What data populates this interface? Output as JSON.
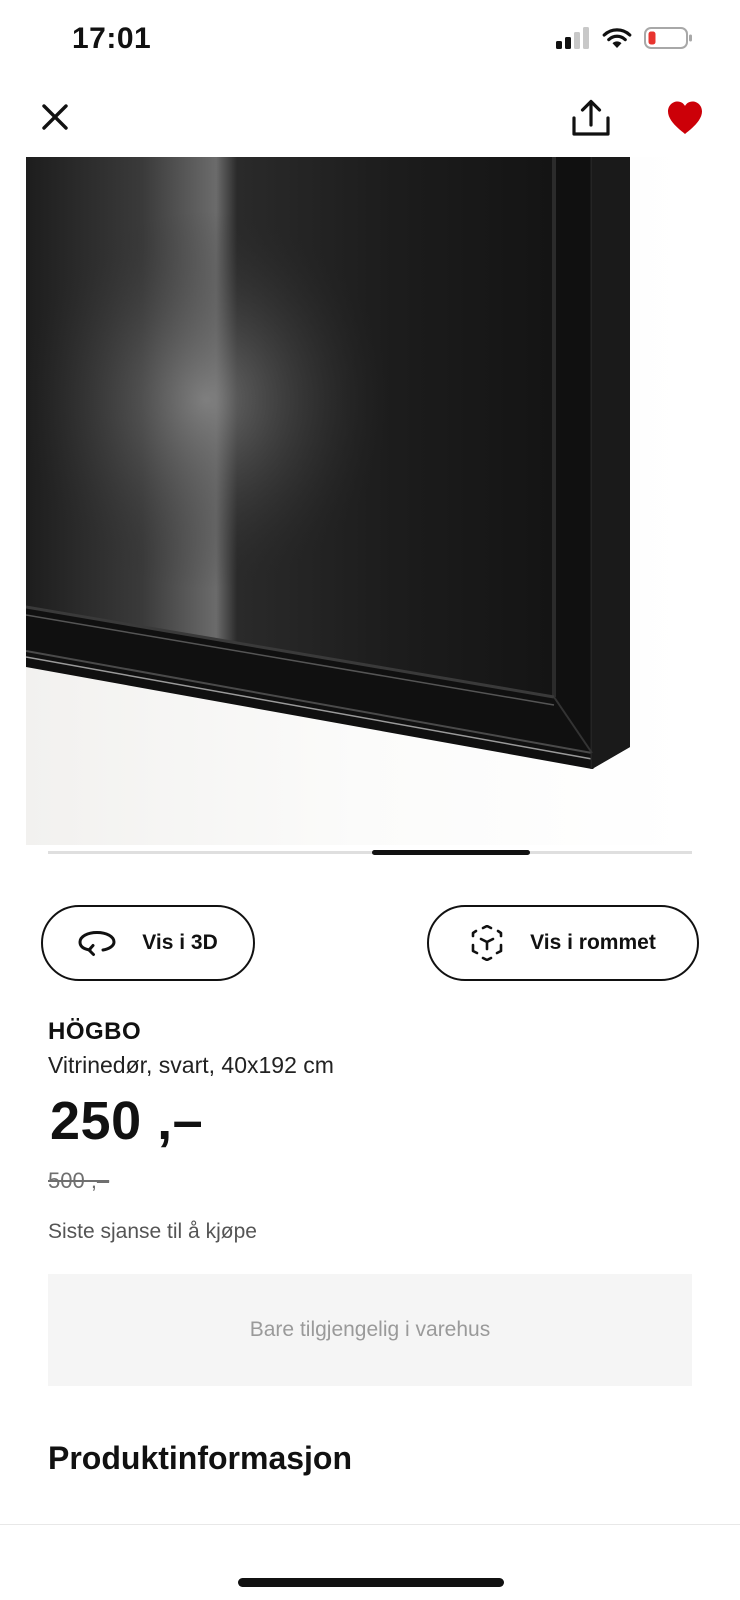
{
  "status_bar": {
    "time": "17:01",
    "icons": [
      "cellular-signal-icon",
      "wifi-icon",
      "battery-low-icon"
    ]
  },
  "toolbar": {
    "icons": [
      "close-icon",
      "share-icon",
      "heart-icon"
    ],
    "favorite_color": "#cc0008"
  },
  "gallery": {
    "image": "black-glass-door-frame-closeup"
  },
  "actions": {
    "view_3d_label": "Vis i 3D",
    "view_3d_icon": "rotate-3d-icon",
    "view_room_label": "Vis i rommet",
    "view_room_icon": "ar-cube-icon"
  },
  "product": {
    "brand": "HÖGBO",
    "description": "Vitrinedør, svart, 40x192 cm",
    "price": "250 ,–",
    "old_price": "500 ,–",
    "notice": "Siste sjanse til å kjøpe",
    "availability": "Bare tilgjengelig i varehus"
  },
  "sections": {
    "product_info_heading": "Produktinformasjon"
  }
}
